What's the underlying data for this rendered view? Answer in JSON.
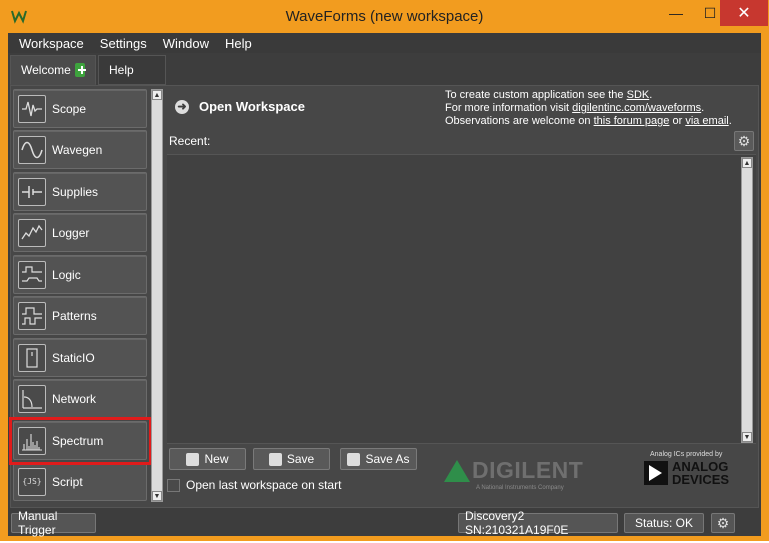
{
  "window": {
    "title": "WaveForms  (new workspace)",
    "min_glyph": "—",
    "max_glyph": "☐",
    "close_glyph": "✕",
    "app_icon": "waveforms-logo-icon"
  },
  "menu": [
    "Workspace",
    "Settings",
    "Window",
    "Help"
  ],
  "tabs": [
    {
      "label": "Welcome",
      "icon": "plus-icon"
    },
    {
      "label": "Help"
    }
  ],
  "tools": [
    {
      "label": "Scope",
      "icon": "scope-icon"
    },
    {
      "label": "Wavegen",
      "icon": "wavegen-icon"
    },
    {
      "label": "Supplies",
      "icon": "supplies-icon"
    },
    {
      "label": "Logger",
      "icon": "logger-icon"
    },
    {
      "label": "Logic",
      "icon": "logic-icon"
    },
    {
      "label": "Patterns",
      "icon": "patterns-icon"
    },
    {
      "label": "StaticIO",
      "icon": "staticio-icon"
    },
    {
      "label": "Network",
      "icon": "network-icon"
    },
    {
      "label": "Spectrum",
      "icon": "spectrum-icon"
    },
    {
      "label": "Script",
      "icon": "script-icon",
      "icon_text": "{JS}"
    }
  ],
  "workspace": {
    "heading": "Open Workspace",
    "info": {
      "line1_prefix": "To create custom application see the ",
      "line1_link": "SDK",
      "line1_suffix": ".",
      "line2_prefix": "For more information visit ",
      "line2_link": "digilentinc.com/waveforms",
      "line2_suffix": ".",
      "line3_prefix": "Observations are welcome on ",
      "line3_link1": "this forum page",
      "line3_mid": " or ",
      "line3_link2": "via email",
      "line3_suffix": "."
    },
    "recent_label": "Recent:",
    "buttons": {
      "new": "New",
      "save": "Save",
      "save_as": "Save As"
    },
    "checkbox_label": "Open last workspace on start",
    "checkbox_checked": false
  },
  "logos": {
    "digilent": "DIGILENT",
    "digilent_sub": "A National Instruments Company",
    "adi_top": "Analog ICs provided by",
    "adi_line1": "ANALOG",
    "adi_line2": "DEVICES"
  },
  "status": {
    "trigger": "Manual Trigger",
    "device": "Discovery2 SN:210321A19F0E",
    "status": "Status: OK"
  },
  "glyphs": {
    "gear": "⚙",
    "arrow_up": "▲",
    "arrow_down": "▼",
    "go": "➜"
  },
  "colors": {
    "titlebar": "#f29c1f",
    "close": "#c7372f",
    "highlight": "#e01b1b",
    "digilent_green": "#2f8e4a"
  }
}
